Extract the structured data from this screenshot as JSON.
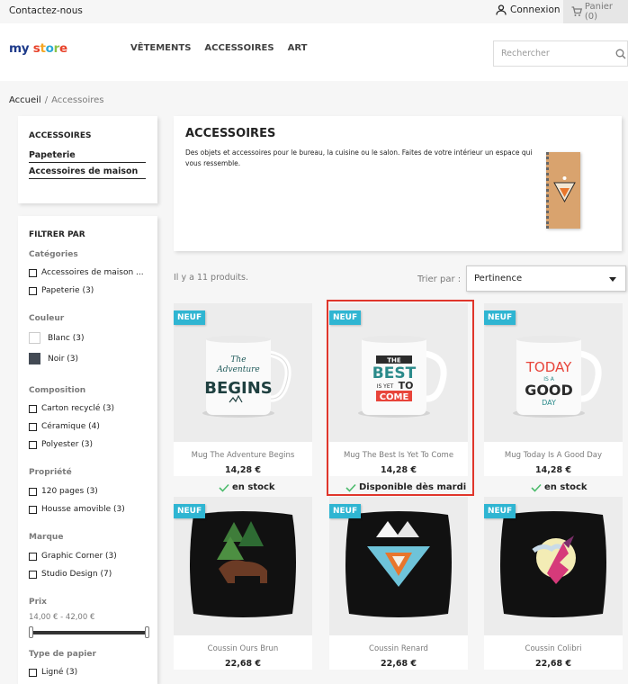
{
  "topbar": {
    "contact": "Contactez-nous",
    "login": "Connexion",
    "cart": "Panier (0)"
  },
  "logo": {
    "my": "my",
    "store": [
      "s",
      "t",
      "o",
      "r",
      "e"
    ]
  },
  "menu": [
    "VÊTEMENTS",
    "ACCESSOIRES",
    "ART"
  ],
  "search": {
    "placeholder": "Rechercher"
  },
  "breadcrumb": {
    "home": "Accueil",
    "sep": "/",
    "current": "Accessoires"
  },
  "categories": {
    "title": "ACCESSOIRES",
    "items": [
      "Papeterie",
      "Accessoires de maison"
    ]
  },
  "filters": {
    "title": "FILTRER PAR",
    "categories": {
      "label": "Catégories",
      "options": [
        "Accessoires de maison ...",
        "Papeterie (3)"
      ]
    },
    "color": {
      "label": "Couleur",
      "options": [
        {
          "label": "Blanc (3)",
          "color": "#ffffff"
        },
        {
          "label": "Noir (3)",
          "color": "#434a54"
        }
      ]
    },
    "composition": {
      "label": "Composition",
      "options": [
        "Carton recyclé (3)",
        "Céramique (4)",
        "Polyester (3)"
      ]
    },
    "property": {
      "label": "Propriété",
      "options": [
        "120 pages (3)",
        "Housse amovible (3)"
      ]
    },
    "brand": {
      "label": "Marque",
      "options": [
        "Graphic Corner (3)",
        "Studio Design (7)"
      ]
    },
    "price": {
      "label": "Prix",
      "range": "14,00 € - 42,00 €"
    },
    "paper": {
      "label": "Type de papier",
      "options": [
        "Ligné (3)"
      ]
    }
  },
  "category_desc": {
    "title": "ACCESSOIRES",
    "text": "Des objets et accessoires pour le bureau, la cuisine ou le salon. Faites de votre intérieur un espace qui vous ressemble."
  },
  "listing": {
    "count": "Il y a 11 produits.",
    "sort_label": "Trier par :",
    "sort_value": "Pertinence"
  },
  "products": [
    {
      "badge": "NEUF",
      "name": "Mug The Adventure Begins",
      "price": "14,28 €",
      "stock": "en stock",
      "icon": "mug-adventure"
    },
    {
      "badge": "NEUF",
      "name": "Mug The Best Is Yet To Come",
      "price": "14,28 €",
      "stock": "Disponible dès mardi",
      "icon": "mug-best"
    },
    {
      "badge": "NEUF",
      "name": "Mug Today Is A Good Day",
      "price": "14,28 €",
      "stock": "en stock",
      "icon": "mug-today"
    },
    {
      "badge": "NEUF",
      "name": "Coussin Ours Brun",
      "price": "22,68 €",
      "icon": "cushion-bear"
    },
    {
      "badge": "NEUF",
      "name": "Coussin Renard",
      "price": "22,68 €",
      "icon": "cushion-fox"
    },
    {
      "badge": "NEUF",
      "name": "Coussin Colibri",
      "price": "22,68 €",
      "icon": "cushion-hummingbird"
    }
  ],
  "mug_texts": {
    "adventure": [
      "The",
      "Adventure",
      "BEGINS"
    ],
    "best": [
      "THE",
      "BEST",
      "IS YET",
      "TO",
      "COME"
    ],
    "today": [
      "TODAY",
      "IS A",
      "GOOD",
      "DAY"
    ]
  },
  "colors": {
    "accent": "#2fb5d2",
    "highlight": "#e0362b",
    "success": "#4cbb6c"
  }
}
